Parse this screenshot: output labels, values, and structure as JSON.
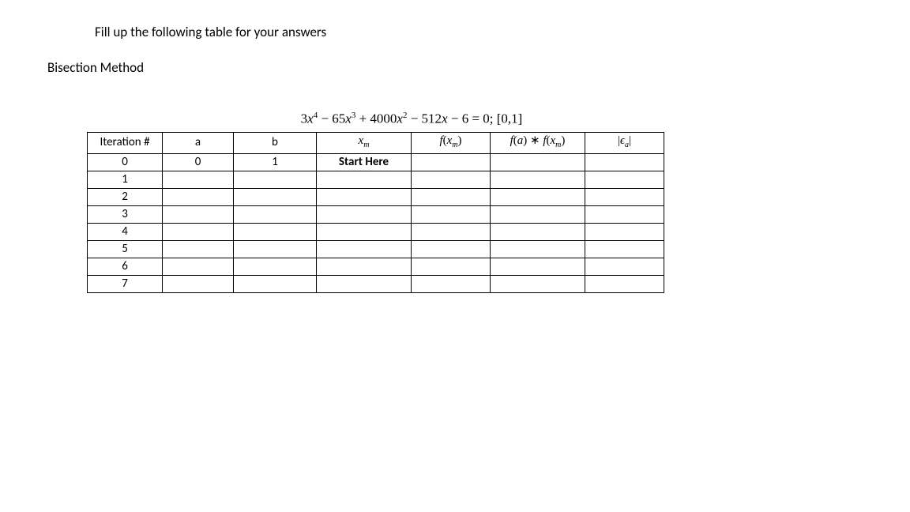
{
  "instruction": "Fill up the following table for your answers",
  "method_title": "Bisection Method",
  "equation": {
    "prefix": "3",
    "x4": "x",
    "x4sup": "4",
    "minus1": " − 65",
    "x3": "x",
    "x3sup": "3",
    "plus1": " + 4000",
    "x2": "x",
    "x2sup": "2",
    "minus2": " − 512",
    "x1": "x",
    "minus3": " − 6 = 0; [0,1]"
  },
  "headers": {
    "iter": "Iteration #",
    "a": "a",
    "b": "b",
    "xm_base": "x",
    "xm_sub": "m",
    "fxm_f": "f",
    "fxm_open": "(",
    "fxm_x": "x",
    "fxm_sub": "m",
    "fxm_close": ")",
    "fafxm_f1": "f",
    "fafxm_o1": "(",
    "fafxm_a": "a",
    "fafxm_c1": ")",
    "fafxm_ast": " ∗ ",
    "fafxm_f2": "f",
    "fafxm_o2": "(",
    "fafxm_x": "x",
    "fafxm_sub": "m",
    "fafxm_c2": ")",
    "ea_bar1": "|",
    "ea_eps": "ϵ",
    "ea_sub": "a",
    "ea_bar2": "|"
  },
  "rows": [
    {
      "iter": "0",
      "a": "0",
      "b": "1",
      "xm": "Start Here",
      "xm_bold": true,
      "fxm": "",
      "fafxm": "",
      "ea": ""
    },
    {
      "iter": "1",
      "a": "",
      "b": "",
      "xm": "",
      "xm_bold": false,
      "fxm": "",
      "fafxm": "",
      "ea": ""
    },
    {
      "iter": "2",
      "a": "",
      "b": "",
      "xm": "",
      "xm_bold": false,
      "fxm": "",
      "fafxm": "",
      "ea": ""
    },
    {
      "iter": "3",
      "a": "",
      "b": "",
      "xm": "",
      "xm_bold": false,
      "fxm": "",
      "fafxm": "",
      "ea": ""
    },
    {
      "iter": "4",
      "a": "",
      "b": "",
      "xm": "",
      "xm_bold": false,
      "fxm": "",
      "fafxm": "",
      "ea": ""
    },
    {
      "iter": "5",
      "a": "",
      "b": "",
      "xm": "",
      "xm_bold": false,
      "fxm": "",
      "fafxm": "",
      "ea": ""
    },
    {
      "iter": "6",
      "a": "",
      "b": "",
      "xm": "",
      "xm_bold": false,
      "fxm": "",
      "fafxm": "",
      "ea": ""
    },
    {
      "iter": "7",
      "a": "",
      "b": "",
      "xm": "",
      "xm_bold": false,
      "fxm": "",
      "fafxm": "",
      "ea": ""
    }
  ]
}
